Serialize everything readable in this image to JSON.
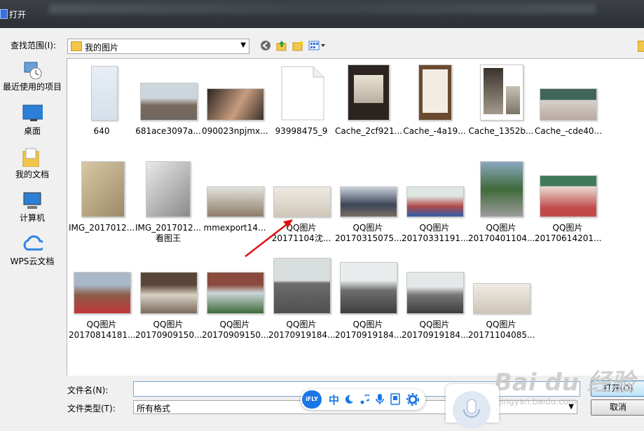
{
  "window": {
    "title": "打开"
  },
  "lookin": {
    "label": "查找范围(I):",
    "value": "我的图片"
  },
  "places": [
    {
      "label": "最近使用的项目",
      "icon": "recent-items-icon"
    },
    {
      "label": "桌面",
      "icon": "desktop-icon"
    },
    {
      "label": "我的文档",
      "icon": "documents-folder-icon"
    },
    {
      "label": "计算机",
      "icon": "computer-icon"
    },
    {
      "label": "WPS云文档",
      "icon": "cloud-icon"
    }
  ],
  "files": [
    {
      "line1": "640",
      "line2": ""
    },
    {
      "line1": "681ace3097a...",
      "line2": ""
    },
    {
      "line1": "090023npjmx...",
      "line2": ""
    },
    {
      "line1": "93998475_9",
      "line2": ""
    },
    {
      "line1": "Cache_2cf921...",
      "line2": ""
    },
    {
      "line1": "Cache_-4a19...",
      "line2": ""
    },
    {
      "line1": "Cache_1352b...",
      "line2": ""
    },
    {
      "line1": "Cache_-cde40...",
      "line2": ""
    },
    {
      "line1": "IMG_2017012...",
      "line2": ""
    },
    {
      "line1": "IMG_2017012...",
      "line2": "看图王"
    },
    {
      "line1": "mmexport14...",
      "line2": ""
    },
    {
      "line1": "QQ图片",
      "line2": "20171104沈..."
    },
    {
      "line1": "QQ图片",
      "line2": "20170315075..."
    },
    {
      "line1": "QQ图片",
      "line2": "20170331191..."
    },
    {
      "line1": "QQ图片",
      "line2": "20170401104..."
    },
    {
      "line1": "QQ图片",
      "line2": "20170614201..."
    },
    {
      "line1": "QQ图片",
      "line2": "20170814181..."
    },
    {
      "line1": "QQ图片",
      "line2": "20170909150..."
    },
    {
      "line1": "QQ图片",
      "line2": "20170909150..."
    },
    {
      "line1": "QQ图片",
      "line2": "20170919184..."
    },
    {
      "line1": "QQ图片",
      "line2": "20170919184..."
    },
    {
      "line1": "QQ图片",
      "line2": "20170919184..."
    },
    {
      "line1": "QQ图片",
      "line2": "20171104085..."
    }
  ],
  "filename": {
    "label": "文件名(N):",
    "value": ""
  },
  "filetype": {
    "label": "文件类型(T):",
    "value": "所有格式"
  },
  "buttons": {
    "open": "打开(O)",
    "cancel": "取消"
  },
  "ifly": {
    "logo": "iFLY",
    "mode": "中"
  },
  "watermark": {
    "main": "Bai du 经验",
    "sub": "jingyan.baidu.com"
  }
}
